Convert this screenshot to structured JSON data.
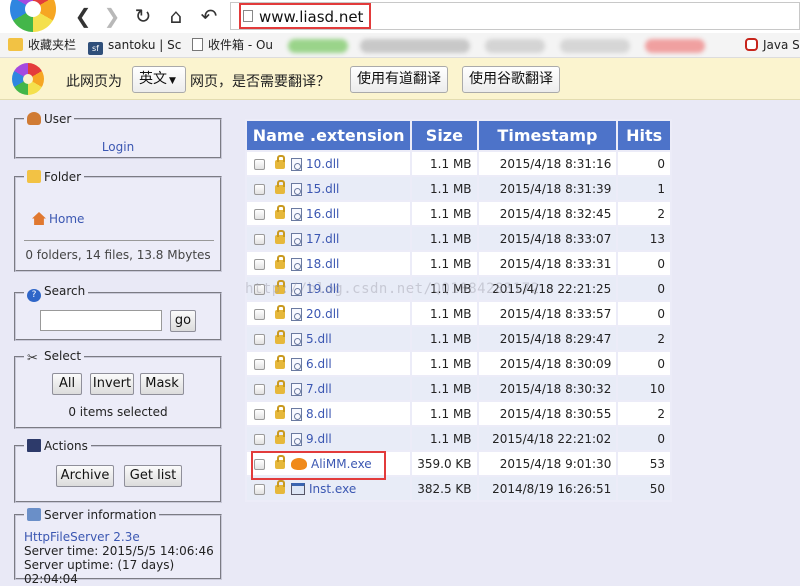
{
  "browser": {
    "url": "www.liasd.net",
    "nav": {
      "back": "❮",
      "forward": "❯",
      "reload": "↻",
      "home": "⌂",
      "undo": "↶"
    },
    "bookmarks": [
      {
        "label": "收藏夹栏",
        "icon": "folder-icon"
      },
      {
        "label": "santoku | Sc",
        "icon": "sf-icon",
        "badge": "sf"
      },
      {
        "label": "收件箱 - Ou",
        "icon": "document-icon"
      },
      {
        "label": "Java S",
        "icon": "oracle-icon"
      }
    ]
  },
  "translate_bar": {
    "text_before": "此网页为",
    "language": "英文",
    "text_after": "网页，是否需要翻译？",
    "youdao_button": "使用有道翻译",
    "google_button": "使用谷歌翻译"
  },
  "sidebar": {
    "user": {
      "legend": "User",
      "login_link": "Login"
    },
    "folder": {
      "legend": "Folder",
      "home_link": "Home",
      "summary": "0 folders, 14 files, 13.8 Mbytes"
    },
    "search": {
      "legend": "Search",
      "input_value": "",
      "go_button": "go"
    },
    "select": {
      "legend": "Select",
      "all_button": "All",
      "invert_button": "Invert",
      "mask_button": "Mask",
      "status": "0 items selected"
    },
    "actions": {
      "legend": "Actions",
      "archive_button": "Archive",
      "getlist_button": "Get list"
    },
    "server": {
      "legend": "Server information",
      "link": "HttpFileServer 2.3e",
      "time": "Server time: 2015/5/5 14:06:46",
      "uptime": "Server uptime: (17 days) 02:04:04"
    }
  },
  "table": {
    "headers": {
      "name": "Name .extension",
      "size": "Size",
      "timestamp": "Timestamp",
      "hits": "Hits"
    },
    "rows": [
      {
        "name": "10.dll",
        "size": "1.1 MB",
        "timestamp": "2015/4/18 8:31:16",
        "hits": "0",
        "type": "dll"
      },
      {
        "name": "15.dll",
        "size": "1.1 MB",
        "timestamp": "2015/4/18 8:31:39",
        "hits": "1",
        "type": "dll"
      },
      {
        "name": "16.dll",
        "size": "1.1 MB",
        "timestamp": "2015/4/18 8:32:45",
        "hits": "2",
        "type": "dll"
      },
      {
        "name": "17.dll",
        "size": "1.1 MB",
        "timestamp": "2015/4/18 8:33:07",
        "hits": "13",
        "type": "dll"
      },
      {
        "name": "18.dll",
        "size": "1.1 MB",
        "timestamp": "2015/4/18 8:33:31",
        "hits": "0",
        "type": "dll"
      },
      {
        "name": "19.dll",
        "size": "1.1 MB",
        "timestamp": "2015/4/18 22:21:25",
        "hits": "0",
        "type": "dll"
      },
      {
        "name": "20.dll",
        "size": "1.1 MB",
        "timestamp": "2015/4/18 8:33:57",
        "hits": "0",
        "type": "dll"
      },
      {
        "name": "5.dll",
        "size": "1.1 MB",
        "timestamp": "2015/4/18 8:29:47",
        "hits": "2",
        "type": "dll"
      },
      {
        "name": "6.dll",
        "size": "1.1 MB",
        "timestamp": "2015/4/18 8:30:09",
        "hits": "0",
        "type": "dll"
      },
      {
        "name": "7.dll",
        "size": "1.1 MB",
        "timestamp": "2015/4/18 8:30:32",
        "hits": "10",
        "type": "dll"
      },
      {
        "name": "8.dll",
        "size": "1.1 MB",
        "timestamp": "2015/4/18 8:30:55",
        "hits": "2",
        "type": "dll"
      },
      {
        "name": "9.dll",
        "size": "1.1 MB",
        "timestamp": "2015/4/18 22:21:02",
        "hits": "0",
        "type": "dll"
      },
      {
        "name": "AliMM.exe",
        "size": "359.0 KB",
        "timestamp": "2015/4/18 9:01:30",
        "hits": "53",
        "type": "exe"
      },
      {
        "name": "Inst.exe",
        "size": "382.5 KB",
        "timestamp": "2014/8/19 16:26:51",
        "hits": "50",
        "type": "win"
      }
    ]
  },
  "watermark": "http://blog.csdn.net/QQ1084283172",
  "colors": {
    "header_bg": "#4d73c9",
    "link": "#3b57b2",
    "highlight": "#e23b3b",
    "translate_bar": "#fbf4cf"
  }
}
